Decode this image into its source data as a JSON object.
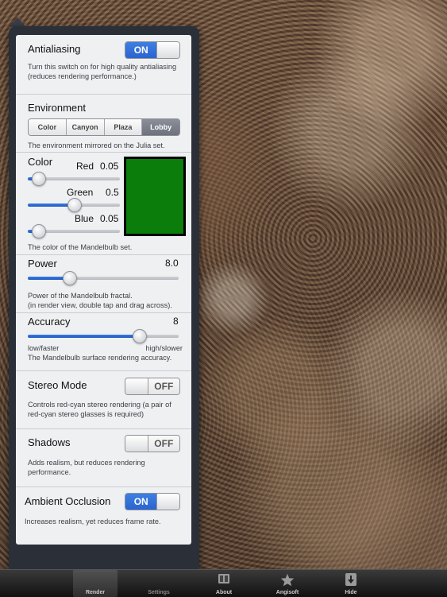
{
  "antialiasing": {
    "title": "Antialiasing",
    "switch_label": "ON",
    "switch_on": true,
    "description_line1": "Turn this switch on for high quality antialiasing",
    "description_line2": "(reduces rendering performance.)"
  },
  "environment": {
    "title": "Environment",
    "options": [
      "Color",
      "Canyon",
      "Plaza",
      "Lobby"
    ],
    "selected": "Lobby",
    "description": "The environment mirrored on the Julia set."
  },
  "color": {
    "title": "Color",
    "red_label": "Red",
    "red_value": "0.05",
    "red_fraction": 0.05,
    "green_label": "Green",
    "green_value": "0.5",
    "green_fraction": 0.5,
    "blue_label": "Blue",
    "blue_value": "0.05",
    "blue_fraction": 0.05,
    "swatch_color": "#0b7d0b",
    "description": "The color of the Mandelbulb set."
  },
  "power": {
    "title": "Power",
    "value": "8.0",
    "slider_fraction": 0.25,
    "description_line1": "Power of the Mandelbulb fractal.",
    "description_line2": "(in render view, double tap and drag across)."
  },
  "accuracy": {
    "title": "Accuracy",
    "value": "8",
    "slider_fraction": 0.76,
    "min_label": "low/faster",
    "max_label": "high/slower",
    "description": "The Mandelbulb surface rendering accuracy."
  },
  "stereo": {
    "title": "Stereo Mode",
    "switch_label": "OFF",
    "switch_on": false,
    "description_line1": "Controls red-cyan stereo rendering (a pair of",
    "description_line2": "red-cyan stereo glasses is required)"
  },
  "shadows": {
    "title": "Shadows",
    "switch_label": "OFF",
    "switch_on": false,
    "description_line1": "Adds realism, but reduces rendering",
    "description_line2": "performance."
  },
  "ambient": {
    "title": "Ambient Occlusion",
    "switch_label": "ON",
    "switch_on": true,
    "description": "Increases realism, yet reduces frame rate."
  },
  "toolbar": {
    "render": "Render",
    "settings": "Settings",
    "about": "About",
    "angisoft": "Angisoft",
    "hide": "Hide"
  },
  "colors": {
    "accent_blue": "#2a64d1",
    "panel_bg": "#eff0f2",
    "popover_frame": "#2b2f38"
  }
}
